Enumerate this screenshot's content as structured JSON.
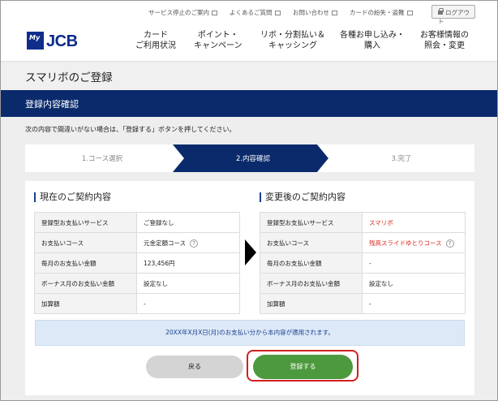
{
  "utility": {
    "links": [
      "サービス停止のご案内",
      "よくあるご質問",
      "お問い合わせ",
      "カードの紛失・盗難"
    ],
    "logout_label": "ログアウト"
  },
  "logo": {
    "my": "My",
    "jcb": "JCB"
  },
  "nav": [
    {
      "line1": "カード",
      "line2": "ご利用状況"
    },
    {
      "line1": "ポイント・",
      "line2": "キャンペーン"
    },
    {
      "line1": "リボ・分割払い＆",
      "line2": "キャッシング"
    },
    {
      "line1": "各種お申し込み・",
      "line2": "購入"
    },
    {
      "line1": "お客様情報の",
      "line2": "照会・変更"
    }
  ],
  "page_title": "スマリボのご登録",
  "section_title": "登録内容確認",
  "instruction": "次の内容で間違いがない場合は、「登録する」ボタンを押してください。",
  "steps": [
    "1.コース選択",
    "2.内容確認",
    "3.完了"
  ],
  "current": {
    "title": "現在のご契約内容",
    "rows": [
      {
        "label": "登録型お支払いサービス",
        "value": "ご登録なし"
      },
      {
        "label": "お支払いコース",
        "value": "元金定額コース"
      },
      {
        "label": "毎月のお支払い金額",
        "value": "123,456円"
      },
      {
        "label": "ボーナス月のお支払い金額",
        "value": "設定なし"
      },
      {
        "label": "加算額",
        "value": "-"
      }
    ]
  },
  "after": {
    "title": "変更後のご契約内容",
    "rows": [
      {
        "label": "登録型お支払いサービス",
        "value": "スマリボ"
      },
      {
        "label": "お支払いコース",
        "value": "残高スライドゆとりコース"
      },
      {
        "label": "毎月のお支払い金額",
        "value": "-"
      },
      {
        "label": "ボーナス月のお支払い金額",
        "value": "設定なし"
      },
      {
        "label": "加算額",
        "value": "-"
      }
    ]
  },
  "help_glyph": "?",
  "notice": "20XX年X月X日(月)のお支払い分から本内容が適用されます。",
  "buttons": {
    "back": "戻る",
    "submit": "登録する"
  },
  "colors": {
    "navy": "#0a2a6c",
    "accent_red": "#d6271f",
    "submit_green": "#4d9a3e",
    "highlight_red": "#d12020"
  }
}
